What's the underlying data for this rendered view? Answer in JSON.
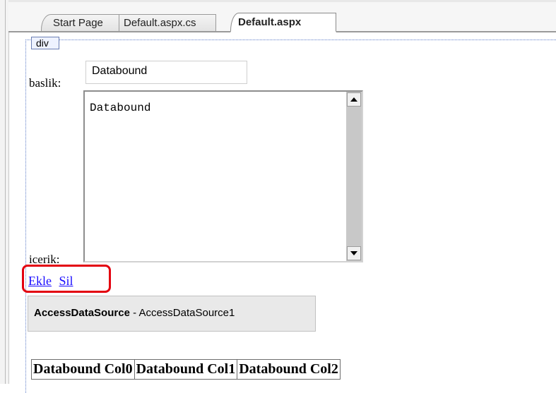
{
  "tabs": [
    {
      "label": "Start Page",
      "active": false
    },
    {
      "label": "Default.aspx.cs",
      "active": false
    },
    {
      "label": "Default.aspx",
      "active": true
    }
  ],
  "surface": {
    "div_tag": "div",
    "baslik_label": "baslik:",
    "baslik_value": "Databound",
    "icerik_label": "icerik:",
    "icerik_value": "Databound",
    "links": [
      "Ekle",
      "Sil"
    ],
    "datasource": {
      "type": "AccessDataSource",
      "separator": " - ",
      "name": "AccessDataSource1"
    },
    "grid_headers": [
      "Databound Col0",
      "Databound Col1",
      "Databound Col2"
    ]
  },
  "colors": {
    "highlight": "#e3000f",
    "link": "#1a0dff"
  },
  "icons": [
    "scroll-up-arrow-icon",
    "scroll-down-arrow-icon"
  ]
}
